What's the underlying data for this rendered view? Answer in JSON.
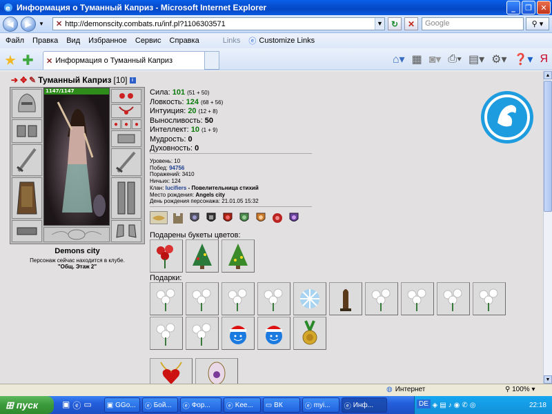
{
  "window": {
    "title": "Информация о Туманный Каприз - Microsoft Internet Explorer",
    "minimize": "_",
    "maximize": "❐",
    "close": "✕"
  },
  "address": {
    "url": "http://demonscity.combats.ru/inf.pl?1106303571"
  },
  "search": {
    "placeholder": "Google"
  },
  "menu": {
    "items": [
      "Файл",
      "Правка",
      "Вид",
      "Избранное",
      "Сервис",
      "Справка"
    ],
    "links": "Links",
    "customize": "Customize Links"
  },
  "tab": {
    "title": "Информация о Туманный Каприз"
  },
  "character": {
    "name": "Туманный Каприз",
    "level": "[10]",
    "hp": "1147/1147",
    "city": "Demons city",
    "location_note": "Персонаж сейчас находится в клубе.",
    "location": "\"Общ. Этаж 2\""
  },
  "stats": [
    {
      "label": "Сила:",
      "value": "101",
      "sub": "(51 + 50)"
    },
    {
      "label": "Ловкость:",
      "value": "124",
      "sub": "(68 + 56)"
    },
    {
      "label": "Интуиция:",
      "value": "20",
      "sub": "(12 + 8)"
    },
    {
      "label": "Выносливость:",
      "value": "50",
      "sub": ""
    },
    {
      "label": "Интеллект:",
      "value": "10",
      "sub": "(1 + 9)"
    },
    {
      "label": "Мудрость:",
      "value": "0",
      "sub": ""
    },
    {
      "label": "Духовность:",
      "value": "0",
      "sub": ""
    }
  ],
  "info": {
    "level_label": "Уровень:",
    "level_value": "10",
    "wins_label": "Побед:",
    "wins_value": "94756",
    "losses_label": "Поражений:",
    "losses_value": "3410",
    "draws_label": "Ничьих:",
    "draws_value": "124",
    "clan_label": "Клан:",
    "clan_name": "lucifiers",
    "clan_title": "- Повелительница стихий",
    "birthplace_label": "Место рождения:",
    "birthplace_value": "Angels city",
    "birthday_label": "День рождения персонажа:",
    "birthday_value": "21.01.05 15:32"
  },
  "bouquets_label": "Подарены букеты цветов:",
  "gifts_label": "Подарки:",
  "status": {
    "zone": "Интернет",
    "zoom": "100%"
  },
  "taskbar": {
    "start": "пуск",
    "buttons": [
      "GGo...",
      "Бой...",
      "Фор...",
      "Kee...",
      "ВК",
      "myi...",
      "Инф..."
    ],
    "lang": "DE",
    "time": "22:18"
  }
}
